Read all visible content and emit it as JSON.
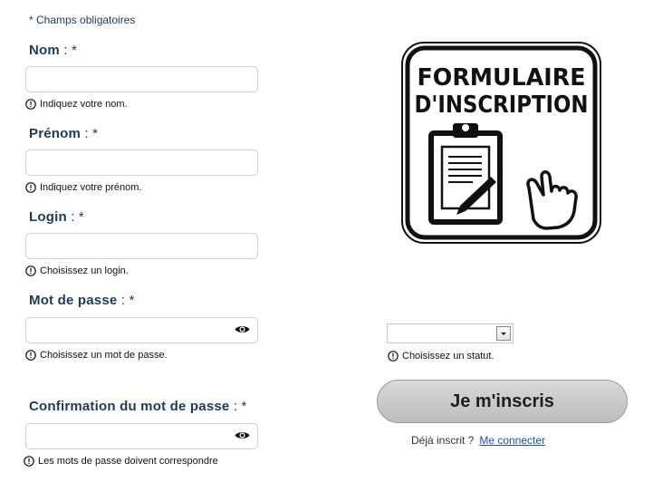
{
  "form": {
    "required_note": "* Champs obligatoires",
    "fields": [
      {
        "label": "Nom",
        "sep": " : *",
        "value": "",
        "hint": "Indiquez votre nom."
      },
      {
        "label": "Prénom",
        "sep": " : *",
        "value": "",
        "hint": "Indiquez votre prénom."
      },
      {
        "label": "Login",
        "sep": " : *",
        "value": "",
        "hint": "Choisissez un login."
      },
      {
        "label": "Mot de passe",
        "sep": " : *",
        "value": "",
        "hint": "Choisissez un mot de passe."
      },
      {
        "label": "Confirmation du mot de passe",
        "sep": " : *",
        "value": "",
        "hint": "Les mots de passe doivent correspondre"
      }
    ],
    "status": {
      "selected": "",
      "hint": "Choisissez un statut."
    },
    "submit_label": "Je m'inscris",
    "already_text": "Déjà inscrit ?",
    "login_link": "Me connecter"
  },
  "logo": {
    "line1": "FORMULAIRE",
    "line2": "D'INSCRIPTION"
  },
  "icons": {
    "hint": "alert-circle-icon",
    "password_toggle": "eye-icon",
    "logo_graphic": "clipboard-pen-hand-icon"
  }
}
